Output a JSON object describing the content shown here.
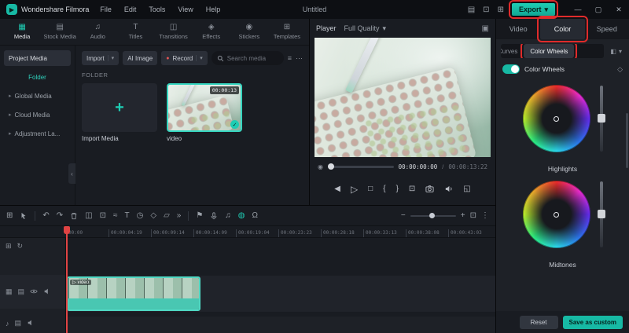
{
  "annotation_color": "#e02b2b",
  "accent_color": "#17b9a4",
  "icons": {
    "logo": "▶",
    "dropdown": "▾",
    "minimize": "—",
    "maximize": "▢",
    "close": "✕",
    "layout": "▤",
    "screen_record": "⊡",
    "plugin_grid": "⊞",
    "tab_media": "▦",
    "tab_stock": "▤",
    "tab_audio": "♫",
    "tab_titles": "T",
    "tab_transitions": "◫",
    "tab_effects": "◈",
    "tab_stickers": "◉",
    "tab_templates": "⊞",
    "arrow_right": "▸",
    "collapse": "‹",
    "record_dot": "●",
    "filter": "≡",
    "more": "⋯",
    "plus": "+",
    "check": "✓",
    "picture": "▣",
    "prev_frame": "◀",
    "play": "▷",
    "stop": "□",
    "mark_in": "{",
    "mark_out": "}",
    "crop": "⊡",
    "fullscreen": "◱",
    "progress_dot": "◉",
    "diamond": "◇",
    "segment_icon": "◧",
    "track_grid": "⊞",
    "undo": "↶",
    "redo": "↷",
    "split": "◫",
    "speed_ramp": "≈",
    "text_tool": "T",
    "timer": "◷",
    "keyframe": "◇",
    "pip": "▱",
    "chroma": "◍",
    "chevrons": "»",
    "marker": "⚑",
    "mixer": "♫",
    "keyframe_solid": "◆",
    "snap": "Ω",
    "zoom_out": "−",
    "zoom_in": "+",
    "fit": "⊡",
    "dots_v": "⋮",
    "video_track": "▦",
    "audio_track": "♪",
    "folder": "▤",
    "refresh": "↻"
  },
  "titlebar": {
    "app_name": "Wondershare Filmora",
    "menus": [
      "File",
      "Edit",
      "Tools",
      "View",
      "Help"
    ],
    "project_title": "Untitled",
    "export_label": "Export"
  },
  "media_panel": {
    "tabs": [
      {
        "label": "Media"
      },
      {
        "label": "Stock Media"
      },
      {
        "label": "Audio"
      },
      {
        "label": "Titles"
      },
      {
        "label": "Transitions"
      },
      {
        "label": "Effects"
      },
      {
        "label": "Stickers"
      },
      {
        "label": "Templates"
      }
    ],
    "sidebar": {
      "items": [
        {
          "label": "Project Media"
        },
        {
          "label": "Folder"
        },
        {
          "label": "Global Media"
        },
        {
          "label": "Cloud Media"
        },
        {
          "label": "Adjustment La..."
        }
      ]
    },
    "toolbar": {
      "import_label": "Import",
      "ai_image_label": "AI Image",
      "record_label": "Record",
      "search_placeholder": "Search media"
    },
    "section_label": "FOLDER",
    "items": [
      {
        "label": "Import Media"
      },
      {
        "label": "video",
        "duration": "00:00:13"
      }
    ]
  },
  "player": {
    "label": "Player",
    "quality_value": "Full Quality",
    "current_time": "00:00:00:00",
    "separator": "/",
    "duration": "00:00:13:22"
  },
  "color_panel": {
    "tabs": [
      "Video",
      "Color",
      "Speed"
    ],
    "active_tab": "Color",
    "segments": [
      "Curves",
      "Color Wheels"
    ],
    "toggle_label": "Color Wheels",
    "wheel_labels": [
      "Highlights",
      "Midtones"
    ],
    "reset_label": "Reset",
    "save_label": "Save as custom"
  },
  "timeline": {
    "ruler_ticks": [
      "00:00",
      "00:00:04:19",
      "00:00:09:14",
      "00:00:14:09",
      "00:00:19:04",
      "00:00:23:23",
      "00:00:28:18",
      "00:00:33:13",
      "00:00:38:08",
      "00:00:43:03"
    ],
    "clip_label": "video"
  }
}
